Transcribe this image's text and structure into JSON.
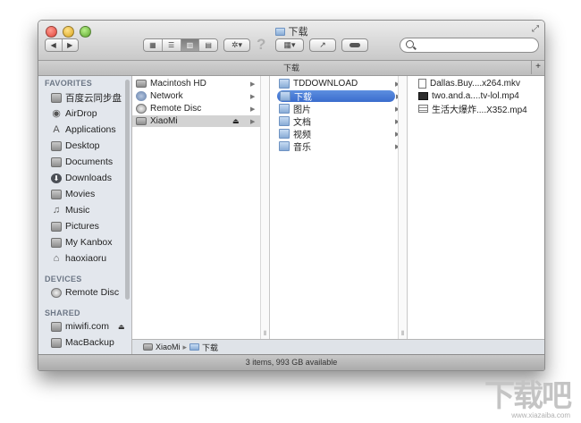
{
  "window": {
    "title": "下载",
    "status": "3 items, 993 GB available",
    "tabbar_title": "下载"
  },
  "toolbar": {
    "back": "◀",
    "forward": "▶",
    "help": "?",
    "search_placeholder": ""
  },
  "sidebar": {
    "favorites_header": "FAVORITES",
    "favorites": [
      {
        "label": "百度云同步盘",
        "icon": "folder-icon"
      },
      {
        "label": "AirDrop",
        "icon": "airdrop-icon"
      },
      {
        "label": "Applications",
        "icon": "applications-icon"
      },
      {
        "label": "Desktop",
        "icon": "desktop-icon"
      },
      {
        "label": "Documents",
        "icon": "documents-icon"
      },
      {
        "label": "Downloads",
        "icon": "downloads-icon"
      },
      {
        "label": "Movies",
        "icon": "movies-icon"
      },
      {
        "label": "Music",
        "icon": "music-icon"
      },
      {
        "label": "Pictures",
        "icon": "pictures-icon"
      },
      {
        "label": "My Kanbox",
        "icon": "folder-icon"
      },
      {
        "label": "haoxiaoru",
        "icon": "home-icon"
      }
    ],
    "devices_header": "DEVICES",
    "devices": [
      {
        "label": "Remote Disc",
        "icon": "disc-icon"
      }
    ],
    "shared_header": "SHARED",
    "shared": [
      {
        "label": "miwifi.com",
        "icon": "server-icon",
        "eject": "⏏"
      },
      {
        "label": "MacBackup",
        "icon": "server-icon"
      }
    ]
  },
  "columns": {
    "col1": [
      {
        "label": "Macintosh HD",
        "icon": "hard-drive-icon"
      },
      {
        "label": "Network",
        "icon": "network-icon"
      },
      {
        "label": "Remote Disc",
        "icon": "disc-icon"
      },
      {
        "label": "XiaoMi",
        "icon": "server-icon",
        "eject": "⏏",
        "selected": "gray"
      }
    ],
    "col2": [
      {
        "label": "TDDOWNLOAD",
        "icon": "folder-icon"
      },
      {
        "label": "下载",
        "icon": "folder-icon",
        "selected": "blue"
      },
      {
        "label": "图片",
        "icon": "folder-icon"
      },
      {
        "label": "文档",
        "icon": "folder-icon"
      },
      {
        "label": "视频",
        "icon": "folder-icon"
      },
      {
        "label": "音乐",
        "icon": "folder-icon"
      }
    ],
    "col3": [
      {
        "label": "Dallas.Buy....x264.mkv",
        "icon": "file-icon"
      },
      {
        "label": "two.and.a....tv-lol.mp4",
        "icon": "video-icon"
      },
      {
        "label": "生活大爆炸....X352.mp4",
        "icon": "document-icon"
      }
    ]
  },
  "pathbar": {
    "items": [
      "XiaoMi",
      "下载"
    ],
    "separator": "▸"
  },
  "watermark": {
    "text": "下载吧",
    "url": "www.xiazaiba.com"
  }
}
